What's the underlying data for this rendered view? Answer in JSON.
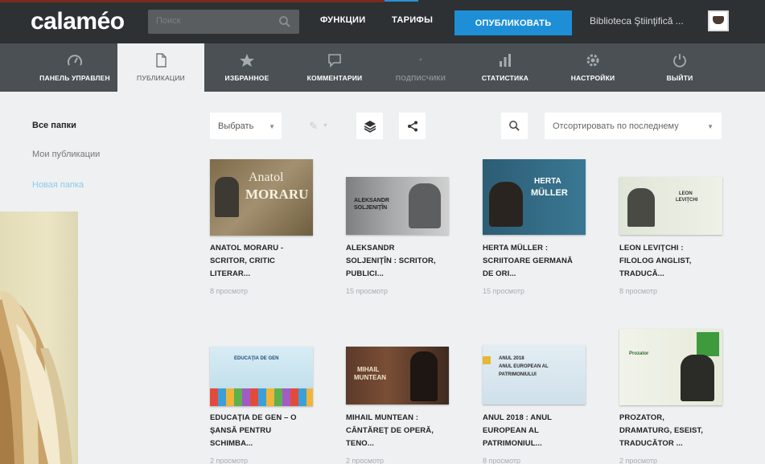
{
  "header": {
    "logo": "calaméo",
    "search_placeholder": "Поиск",
    "links": [
      "ФУНКЦИИ",
      "ТАРИФЫ"
    ],
    "publish_label": "ОПУБЛИКОВАТЬ",
    "username": "Biblioteca Ştiinţifică ...",
    "accent_color": "#1e8fd6"
  },
  "subnav": {
    "items": [
      {
        "label": "ПАНЕЛЬ УПРАВЛЕН",
        "icon": "gauge-icon",
        "state": "normal"
      },
      {
        "label": "ПУБЛИКАЦИИ",
        "icon": "document-icon",
        "state": "active"
      },
      {
        "label": "ИЗБРАННОЕ",
        "icon": "star-icon",
        "state": "normal"
      },
      {
        "label": "КОММЕНТАРИИ",
        "icon": "comment-icon",
        "state": "normal"
      },
      {
        "label": "ПОДПИСЧИКИ",
        "icon": "subscribers-icon",
        "state": "disabled"
      },
      {
        "label": "СТАТИСТИКА",
        "icon": "bar-chart-icon",
        "state": "normal"
      },
      {
        "label": "НАСТРОЙКИ",
        "icon": "gear-icon",
        "state": "normal"
      },
      {
        "label": "ВЫЙТИ",
        "icon": "power-icon",
        "state": "normal"
      }
    ]
  },
  "sidebar": {
    "items": [
      {
        "label": "Все папки",
        "style": "bold"
      },
      {
        "label": "Мои публикации",
        "style": "grey"
      },
      {
        "label": "Новая папка",
        "style": "blue"
      }
    ]
  },
  "toolbar": {
    "select_label": "Выбрать",
    "sort_label": "Отсортировать по последнему"
  },
  "publications": [
    {
      "title_lines": [
        "ANATOL MORARU -",
        "SCRITOR, CRITIC",
        "LITERAR..."
      ],
      "views": "8 просмотр",
      "cover_text": [
        "Anatol",
        "MORARU"
      ]
    },
    {
      "title_lines": [
        "ALEKSANDR",
        "SOLJENIŢÎN : SCRITOR,",
        "PUBLICI..."
      ],
      "views": "15 просмотр",
      "cover_text": [
        "ALEKSANDR",
        "SOLJENIŢÎN"
      ]
    },
    {
      "title_lines": [
        "HERTA MÜLLER :",
        "SCRIITOARE GERMANĂ",
        "DE ORI..."
      ],
      "views": "15 просмотр",
      "cover_text": [
        "HERTA",
        "MÜLLER"
      ]
    },
    {
      "title_lines": [
        "LEON LEVIŢCHI :",
        "FILOLOG ANGLIST,",
        "TRADUCĂ..."
      ],
      "views": "8 просмотр",
      "cover_text": [
        "LEON",
        "LEVIŢCHI"
      ]
    },
    {
      "title_lines": [
        "EDUCAŢIA DE GEN – O",
        "ŞANSĂ PENTRU",
        "SCHIMBA..."
      ],
      "views": "2 просмотр",
      "cover_text": [
        "EDUCAŢIA DE GEN"
      ]
    },
    {
      "title_lines": [
        "MIHAIL MUNTEAN :",
        "CÂNTĂREŢ DE OPERĂ,",
        "TENO..."
      ],
      "views": "2 просмотр",
      "cover_text": [
        "MIHAIL",
        "MUNTEAN"
      ]
    },
    {
      "title_lines": [
        "ANUL 2018 : ANUL",
        "EUROPEAN AL",
        "PATRIMONIUL..."
      ],
      "views": "8 просмотр",
      "cover_text": [
        "ANUL 2018",
        "ANUL EUROPEAN AL",
        "PATRIMONIULUI"
      ]
    },
    {
      "title_lines": [
        "PROZATOR,",
        "DRAMATURG, ESEIST,",
        "TRADUCĂTOR ..."
      ],
      "views": "2 просмотр",
      "cover_text": [
        "Prozator"
      ]
    }
  ]
}
